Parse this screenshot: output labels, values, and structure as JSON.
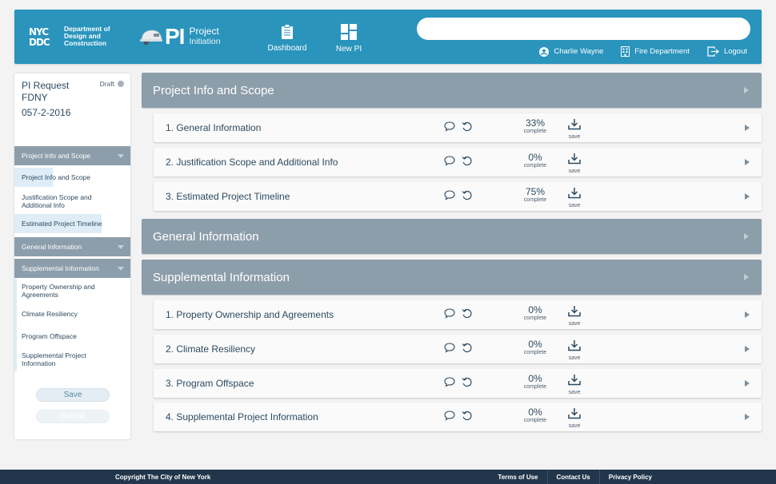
{
  "header": {
    "logo_mark": "NYC DDC",
    "logo_text_lines": [
      "Department of",
      "Design and",
      "Construction"
    ],
    "app_letters": "PI",
    "app_title": "Project",
    "app_subtitle": "Initiation",
    "nav": [
      {
        "label": "Dashboard",
        "icon": "clipboard-icon"
      },
      {
        "label": "New PI",
        "icon": "grid-icon"
      }
    ],
    "search": {
      "value": "",
      "placeholder": ""
    },
    "user_name": "Charlie Wayne",
    "agency": "Fire Department",
    "logout_label": "Logout"
  },
  "sidebar": {
    "request_title_line1": "PI Request",
    "request_title_line2": "FDNY",
    "request_id": "057-2-2016",
    "status": "Draft",
    "sections": [
      {
        "label": "Project Info and Scope",
        "items": [
          {
            "label": "Project Info and Scope",
            "progress": 33
          },
          {
            "label": "Justification Scope and Additional Info",
            "progress": 0
          },
          {
            "label": "Estimated Project Timeline",
            "progress": 75
          }
        ]
      },
      {
        "label": "General Information",
        "items": []
      },
      {
        "label": "Supplemental Information",
        "items": [
          {
            "label": "Property Ownership and Agreements",
            "progress": 0
          },
          {
            "label": "Climate Resiliency",
            "progress": 0
          },
          {
            "label": "Program Offspace",
            "progress": 0
          },
          {
            "label": "Supplemental Project Information",
            "progress": 0
          }
        ]
      }
    ],
    "save_label": "Save",
    "submit_label": "Submit"
  },
  "main": {
    "complete_label": "complete",
    "save_label": "save",
    "sections": [
      {
        "title": "Project Info and Scope",
        "rows": [
          {
            "title": "1. General Information",
            "percent": "33%"
          },
          {
            "title": "2. Justification Scope and Additional Info",
            "percent": "0%"
          },
          {
            "title": "3. Estimated Project Timeline",
            "percent": "75%"
          }
        ]
      },
      {
        "title": "General Information",
        "rows": []
      },
      {
        "title": "Supplemental Information",
        "rows": [
          {
            "title": "1. Property Ownership and Agreements",
            "percent": "0%"
          },
          {
            "title": "2. Climate Resiliency",
            "percent": "0%"
          },
          {
            "title": "3. Program Offspace",
            "percent": "0%"
          },
          {
            "title": "4. Supplemental Project Information",
            "percent": "0%"
          }
        ]
      }
    ]
  },
  "footer": {
    "copyright": "Copyright The City of New York",
    "links": [
      "Terms of Use",
      "Contact Us",
      "Privacy Policy"
    ]
  },
  "colors": {
    "header_bg": "#2a94bc",
    "section_bg": "#8d9eab",
    "footer_bg": "#22364b",
    "progress_fill": "#deedf7",
    "text": "#2d4a60"
  }
}
